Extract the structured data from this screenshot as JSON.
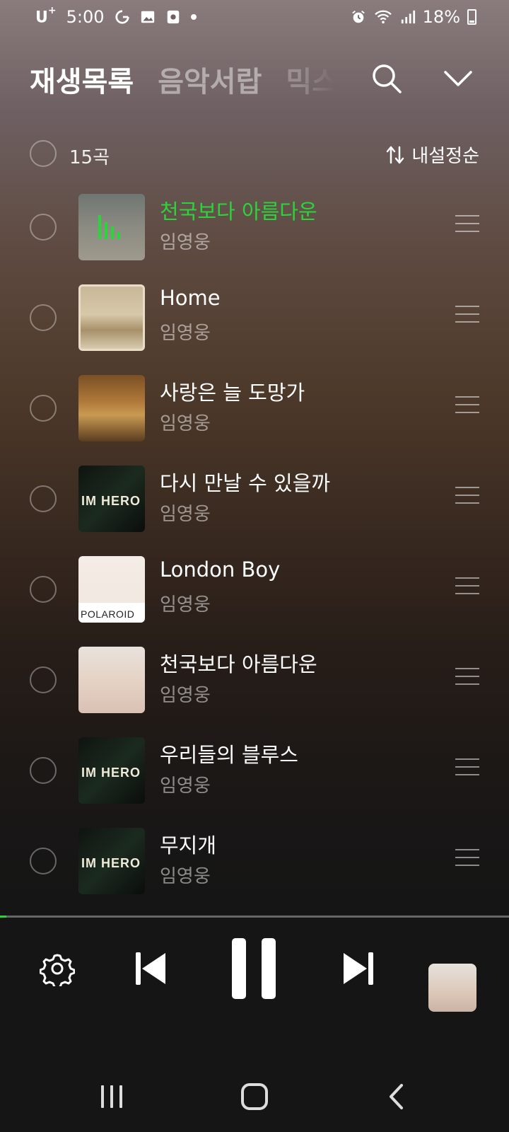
{
  "status_bar": {
    "carrier": "U",
    "carrier_sup": "+",
    "time": "5:00",
    "battery": "18%"
  },
  "tabs": [
    {
      "label": "재생목록",
      "active": true
    },
    {
      "label": "음악서랍",
      "active": false
    },
    {
      "label": "믹스",
      "active": false
    }
  ],
  "list_header": {
    "count": "15곡",
    "sort_label": "내설정순"
  },
  "songs": [
    {
      "title": "천국보다 아름다운",
      "artist": "임영웅",
      "playing": true
    },
    {
      "title": "Home",
      "artist": "임영웅",
      "playing": false
    },
    {
      "title": "사랑은 늘 도망가",
      "artist": "임영웅",
      "playing": false
    },
    {
      "title": "다시 만날 수 있을까",
      "artist": "임영웅",
      "playing": false
    },
    {
      "title": "London Boy",
      "artist": "임영웅",
      "playing": false,
      "art_text": "POLAROID"
    },
    {
      "title": "천국보다 아름다운",
      "artist": "임영웅",
      "playing": false
    },
    {
      "title": "우리들의 블루스",
      "artist": "임영웅",
      "playing": false
    },
    {
      "title": "무지개",
      "artist": "임영웅",
      "playing": false
    }
  ],
  "album_art_text": {
    "im_hero": "IM HERO",
    "polaroid": "POLAROID"
  },
  "player": {
    "progress": 0.012,
    "state": "playing"
  },
  "colors": {
    "accent": "#2bd43b",
    "bar_bg": "#151515"
  },
  "icons": [
    "search-icon",
    "chevron-down-icon",
    "sort-icon",
    "drag-handle-icon",
    "settings-icon",
    "previous-icon",
    "pause-icon",
    "next-icon",
    "recents-icon",
    "home-icon",
    "back-icon"
  ]
}
